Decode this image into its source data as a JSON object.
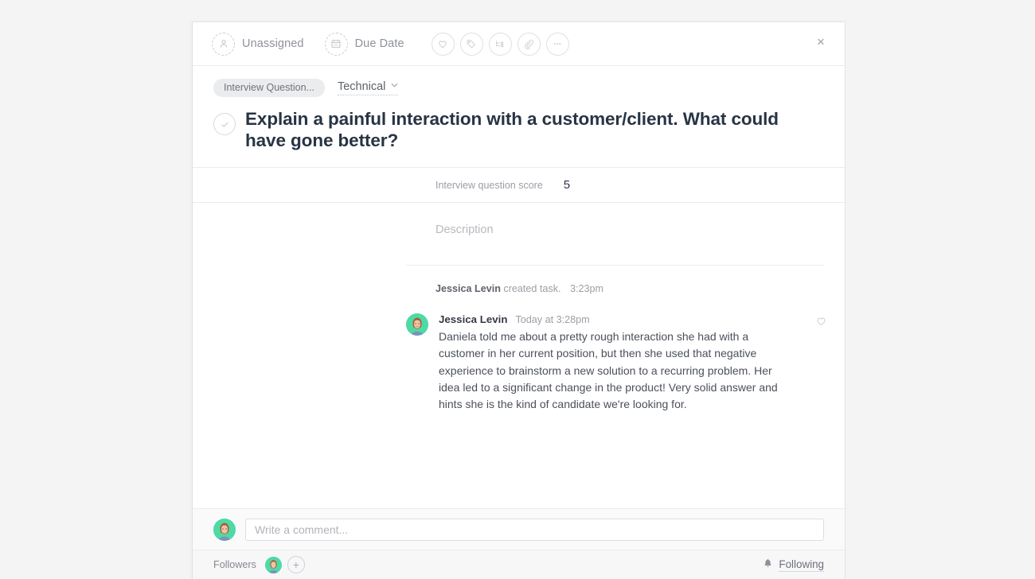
{
  "header": {
    "assignee_label": "Unassigned",
    "assignee_icon": "person-icon",
    "due_date_label": "Due Date",
    "due_date_icon": "calendar-icon",
    "icon_buttons": [
      {
        "name": "like-icon",
        "title": "Like"
      },
      {
        "name": "tag-icon",
        "title": "Tag"
      },
      {
        "name": "subtask-icon",
        "title": "Subtask"
      },
      {
        "name": "attachment-icon",
        "title": "Attach"
      },
      {
        "name": "more-icon",
        "title": "More"
      }
    ],
    "close_icon": "close-icon",
    "close_label": "×"
  },
  "task": {
    "project_pill": "Interview Question...",
    "section_dropdown": "Technical",
    "caret": "⌄",
    "title": "Explain a painful interaction with a customer/client. What could have gone better?",
    "complete_icon": "check-icon",
    "score_label": "Interview question score",
    "score_value": "5",
    "description_placeholder": "Description"
  },
  "activity": {
    "creator": "Jessica Levin",
    "action": "created task.",
    "time": "3:23pm"
  },
  "comment": {
    "author": "Jessica Levin",
    "timestamp": "Today at 3:28pm",
    "text": "Daniela told me about a pretty rough interaction she had with a customer in her current position, but then she used that negative experience to brainstorm a new solution to a recurring problem. Her idea led to a significant change in the product! Very solid answer and hints she is the kind of candidate we're looking for.",
    "like_icon": "heart-icon"
  },
  "composer": {
    "placeholder": "Write a comment...",
    "value": "",
    "avatar_name": "current-user-avatar"
  },
  "footer": {
    "followers_label": "Followers",
    "add_follower_label": "+",
    "following_label": "Following",
    "bell_icon": "bell-icon"
  },
  "colors": {
    "page_background": "#f4f4f5",
    "panel_background": "#ffffff",
    "title_text": "#283444",
    "muted_text": "#9b9ea5",
    "divider": "#ececee",
    "pill_background": "#ebecee",
    "avatar_background": "#4fd9a6"
  }
}
